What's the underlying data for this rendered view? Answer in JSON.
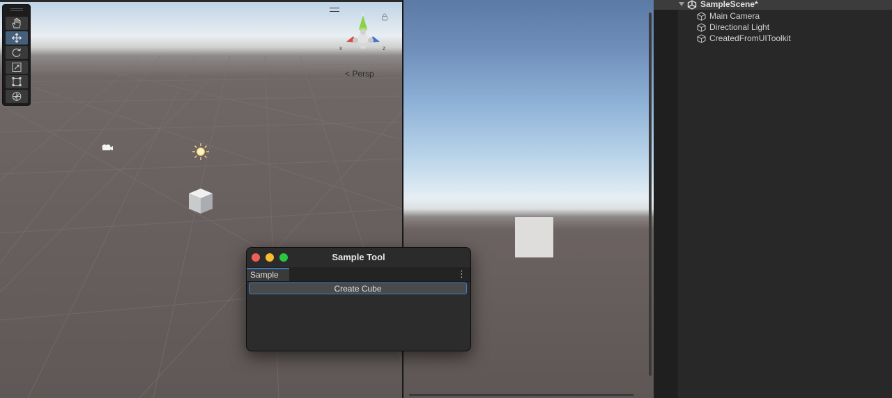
{
  "scene_view": {
    "persp_label": "Persp",
    "gizmo_axes": {
      "y": "y",
      "x": "x",
      "z": "z"
    },
    "tools": [
      {
        "name": "hand-tool",
        "active": false
      },
      {
        "name": "move-tool",
        "active": true
      },
      {
        "name": "rotate-tool",
        "active": false
      },
      {
        "name": "scale-tool",
        "active": false
      },
      {
        "name": "rect-tool",
        "active": false
      },
      {
        "name": "transform-tool",
        "active": false
      }
    ]
  },
  "hierarchy": {
    "scene_name": "SampleScene*",
    "items": [
      "Main Camera",
      "Directional Light",
      "CreatedFromUIToolkit"
    ]
  },
  "tool_window": {
    "title": "Sample Tool",
    "tab_label": "Sample Tool",
    "kebab": "⋮",
    "create_button_label": "Create Cube"
  },
  "colors": {
    "accent": "#3b7fd1",
    "close": "#ed5f57",
    "minimize": "#f5bd2f",
    "maximize": "#28c840"
  }
}
